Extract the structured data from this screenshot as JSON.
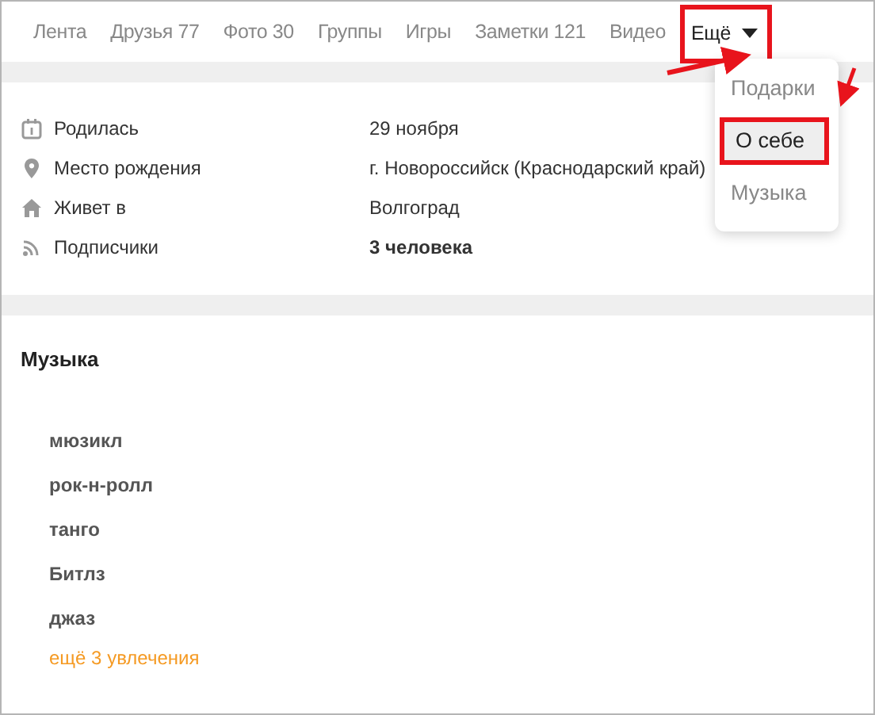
{
  "nav": {
    "items": [
      {
        "label": "Лента",
        "selected": false,
        "highlighted": false
      },
      {
        "label": "Друзья",
        "count": "77",
        "selected": false,
        "highlighted": false
      },
      {
        "label": "Фото",
        "count": "30",
        "selected": false,
        "highlighted": false
      },
      {
        "label": "Группы",
        "selected": false,
        "highlighted": false
      },
      {
        "label": "Игры",
        "selected": false,
        "highlighted": false
      },
      {
        "label": "Заметки",
        "count": "121",
        "selected": false,
        "highlighted": false
      },
      {
        "label": "Видео",
        "selected": false,
        "highlighted": false
      },
      {
        "label": "Ещё",
        "selected": true,
        "highlighted": true,
        "kind": "dropdown"
      }
    ]
  },
  "menu": {
    "items": [
      {
        "label": "Подарки",
        "selected": false,
        "highlighted": false
      },
      {
        "label": "О себе",
        "selected": true,
        "highlighted": true
      },
      {
        "label": "Музыка",
        "selected": false,
        "highlighted": false
      }
    ]
  },
  "info": {
    "rows": [
      {
        "kind": "calendar",
        "label": "Родилась",
        "value": "29 ноября"
      },
      {
        "kind": "pin",
        "label": "Место рождения",
        "value": "г. Новороссийск (Краснодарский край)"
      },
      {
        "kind": "home",
        "label": "Живет в",
        "value": "Волгоград"
      },
      {
        "kind": "feed",
        "label": "Подписчики",
        "value": "3 человека",
        "bold": true
      }
    ]
  },
  "music": {
    "title": "Музыка",
    "items": [
      "мюзикл",
      "рок-н-ролл",
      "танго",
      "Битлз",
      "джаз"
    ],
    "more_link": "ещё 3 увлечения"
  }
}
